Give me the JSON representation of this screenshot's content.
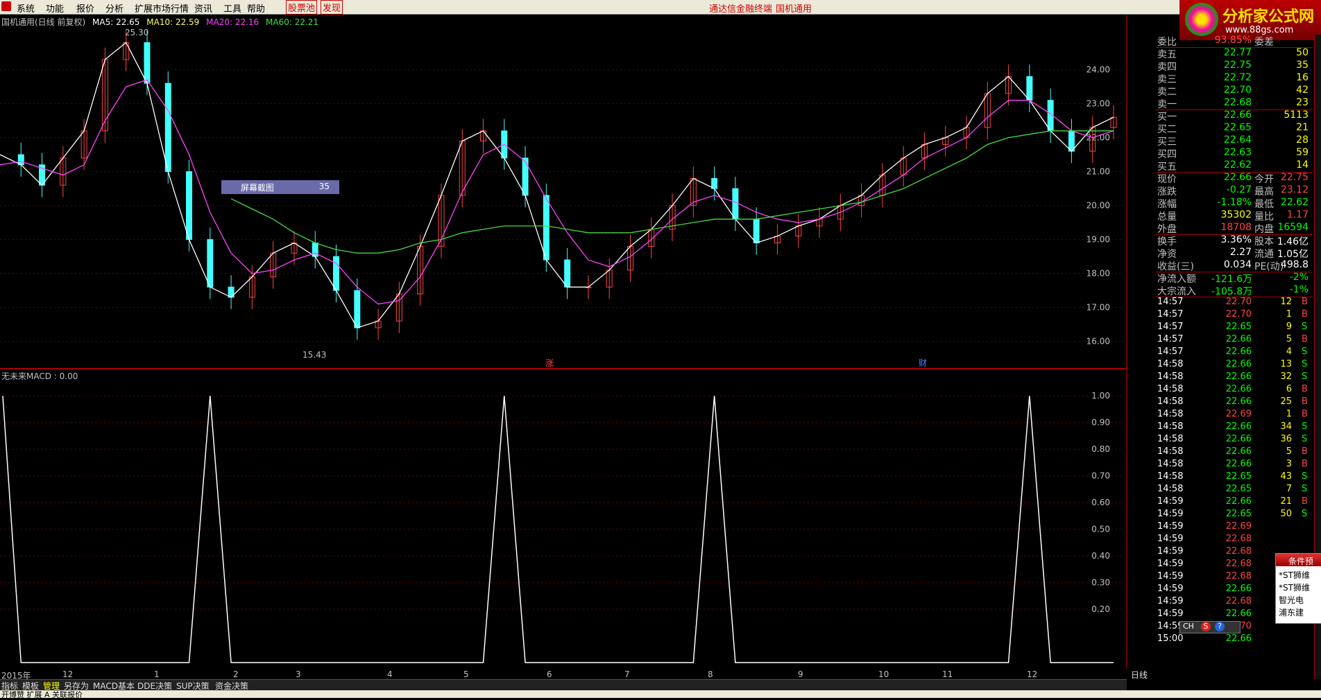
{
  "menu": {
    "items": [
      "系统",
      "功能",
      "报价",
      "分析",
      "扩展市场行情",
      "资讯",
      "工具",
      "帮助"
    ],
    "highlight_items": [
      "股票池",
      "发现"
    ],
    "center_links": [
      "通达信金融终端",
      "国机通用"
    ]
  },
  "brand": {
    "name": "分析家公式网",
    "url": "www.88gs.com"
  },
  "chart": {
    "title": "国机通用(日线 前复权)",
    "ma": [
      {
        "label": "MA5: 22.65",
        "color": "#ffffff"
      },
      {
        "label": "MA10: 22.59",
        "color": "#ffff66"
      },
      {
        "label": "MA20: 22.16",
        "color": "#ff44ff"
      },
      {
        "label": "MA60: 22.21",
        "color": "#44dd44"
      }
    ],
    "high_label": "25.30",
    "low_label": "15.43",
    "markers": [
      "涨",
      "财"
    ],
    "popup": {
      "text": "屏幕截图",
      "value": "35"
    }
  },
  "chart_data": [
    {
      "type": "candlestick",
      "title": "国机通用(日线 前复权)",
      "ylim": [
        15.4,
        25.4
      ],
      "y_ticks": [
        "24.00",
        "23.00",
        "22.00",
        "21.00",
        "20.00",
        "19.00",
        "18.00",
        "17.00",
        "16.00"
      ],
      "x_ticks": [
        "2015年",
        "12",
        "1",
        "2",
        "3",
        "4",
        "5",
        "6",
        "7",
        "8",
        "9",
        "10",
        "11",
        "12"
      ],
      "period_label": "日线",
      "series": [
        {
          "name": "MA5",
          "values": [
            21.5,
            21.2,
            20.6,
            21.4,
            22.2,
            24.3,
            24.8,
            23.6,
            21.0,
            19.0,
            17.6,
            17.3,
            17.9,
            18.6,
            18.9,
            18.5,
            17.5,
            16.4,
            16.6,
            17.4,
            18.8,
            20.3,
            21.9,
            22.2,
            21.4,
            20.3,
            18.4,
            17.6,
            17.6,
            18.1,
            18.8,
            19.3,
            20.0,
            20.8,
            20.5,
            19.6,
            18.9,
            19.1,
            19.4,
            19.6,
            20.0,
            20.3,
            20.9,
            21.4,
            21.8,
            22.0,
            22.3,
            23.3,
            23.8,
            23.1,
            22.2,
            21.6,
            22.3,
            22.6
          ]
        },
        {
          "name": "MA20",
          "values": [
            21.2,
            21.3,
            21.1,
            20.9,
            21.2,
            22.5,
            23.5,
            23.7,
            22.8,
            21.5,
            19.8,
            18.6,
            18.0,
            18.1,
            18.4,
            18.6,
            18.3,
            17.6,
            17.1,
            17.2,
            17.9,
            19.0,
            20.4,
            21.5,
            21.8,
            21.3,
            20.2,
            19.2,
            18.4,
            18.2,
            18.5,
            19.0,
            19.6,
            20.1,
            20.3,
            20.1,
            19.8,
            19.6,
            19.5,
            19.6,
            19.8,
            20.1,
            20.5,
            20.9,
            21.4,
            21.7,
            22.0,
            22.6,
            23.1,
            23.1,
            22.7,
            22.2,
            22.0,
            22.2
          ]
        },
        {
          "name": "MA60",
          "values": [
            null,
            null,
            null,
            null,
            null,
            null,
            null,
            null,
            null,
            null,
            null,
            20.2,
            19.9,
            19.6,
            19.2,
            18.9,
            18.7,
            18.6,
            18.6,
            18.7,
            18.9,
            19.0,
            19.2,
            19.3,
            19.4,
            19.4,
            19.4,
            19.3,
            19.2,
            19.2,
            19.2,
            19.3,
            19.4,
            19.5,
            19.6,
            19.6,
            19.6,
            19.7,
            19.8,
            19.9,
            20.0,
            20.1,
            20.3,
            20.5,
            20.8,
            21.1,
            21.4,
            21.8,
            22.0,
            22.1,
            22.2,
            22.2,
            22.2,
            22.2
          ]
        }
      ]
    },
    {
      "type": "line",
      "title": "无未来MACD : 0.00",
      "ylim": [
        0,
        1.05
      ],
      "y_ticks": [
        "1.00",
        "0.90",
        "0.80",
        "0.70",
        "0.60",
        "0.50",
        "0.40",
        "0.30",
        "0.20"
      ],
      "series": [
        {
          "name": "无未来MACD",
          "values": [
            1,
            0,
            0,
            0,
            0,
            0,
            0,
            0,
            0,
            0,
            1,
            0,
            0,
            0,
            0,
            0,
            0,
            0,
            0,
            0,
            0,
            0,
            0,
            0,
            1,
            0,
            0,
            0,
            0,
            0,
            0,
            0,
            0,
            0,
            1,
            0,
            0,
            0,
            0,
            0,
            0,
            0,
            0,
            0,
            0,
            0,
            0,
            0,
            0,
            1,
            0,
            0,
            0,
            0
          ]
        }
      ]
    }
  ],
  "quote": {
    "header": {
      "label": "委比",
      "value": "93.85%",
      "extra": "委差"
    },
    "asks": [
      {
        "label": "卖五",
        "price": "22.77",
        "qty": "50"
      },
      {
        "label": "卖四",
        "price": "22.75",
        "qty": "35"
      },
      {
        "label": "卖三",
        "price": "22.72",
        "qty": "16"
      },
      {
        "label": "卖二",
        "price": "22.70",
        "qty": "42"
      },
      {
        "label": "卖一",
        "price": "22.68",
        "qty": "23"
      }
    ],
    "bids": [
      {
        "label": "买一",
        "price": "22.66",
        "qty": "5113"
      },
      {
        "label": "买二",
        "price": "22.65",
        "qty": "21"
      },
      {
        "label": "买三",
        "price": "22.64",
        "qty": "28"
      },
      {
        "label": "买四",
        "price": "22.63",
        "qty": "59"
      },
      {
        "label": "买五",
        "price": "22.62",
        "qty": "14"
      }
    ],
    "stats": [
      {
        "l": "现价",
        "v": "22.66",
        "vc": "#00ff00",
        "l2": "今开",
        "q": "22.75",
        "qc": "#ff4444"
      },
      {
        "l": "涨跌",
        "v": "-0.27",
        "vc": "#00ff00",
        "l2": "最高",
        "q": "23.12",
        "qc": "#ff4444"
      },
      {
        "l": "涨幅",
        "v": "-1.18%",
        "vc": "#00ff00",
        "l2": "最低",
        "q": "22.62",
        "qc": "#00ff00"
      },
      {
        "l": "总量",
        "v": "35302",
        "vc": "#ffff00",
        "l2": "量比",
        "q": "1.17",
        "qc": "#ff4444"
      },
      {
        "l": "外盘",
        "v": "18708",
        "vc": "#ff4444",
        "l2": "内盘",
        "q": "16594",
        "qc": "#00ff00"
      }
    ],
    "stats2": [
      {
        "l": "换手",
        "v": "3.36%",
        "vc": "#ffffff",
        "l2": "股本",
        "q": "1.46亿",
        "qc": "#ffffff"
      },
      {
        "l": "净资",
        "v": "2.27",
        "vc": "#ffffff",
        "l2": "流通",
        "q": "1.05亿",
        "qc": "#ffffff"
      },
      {
        "l": "收益(三)",
        "v": "0.034",
        "vc": "#ffffff",
        "l2": "PE(动)",
        "q": "498.8",
        "qc": "#ffffff"
      }
    ],
    "flows": [
      {
        "l": "净流入额",
        "v": "-121.6万",
        "p": "-2%"
      },
      {
        "l": "大宗流入",
        "v": "-105.8万",
        "p": "-1%"
      }
    ]
  },
  "ticks": [
    {
      "t": "14:57",
      "p": "22.70",
      "pc": "#ff4444",
      "n": "12",
      "s": "B"
    },
    {
      "t": "14:57",
      "p": "22.70",
      "pc": "#ff4444",
      "n": "1",
      "s": "B"
    },
    {
      "t": "14:57",
      "p": "22.65",
      "pc": "#00ff00",
      "n": "9",
      "s": "S"
    },
    {
      "t": "14:57",
      "p": "22.66",
      "pc": "#00ff00",
      "n": "5",
      "s": "B"
    },
    {
      "t": "14:57",
      "p": "22.66",
      "pc": "#00ff00",
      "n": "4",
      "s": "S"
    },
    {
      "t": "14:58",
      "p": "22.66",
      "pc": "#00ff00",
      "n": "13",
      "s": "S"
    },
    {
      "t": "14:58",
      "p": "22.66",
      "pc": "#00ff00",
      "n": "32",
      "s": "S"
    },
    {
      "t": "14:58",
      "p": "22.66",
      "pc": "#00ff00",
      "n": "6",
      "s": "B"
    },
    {
      "t": "14:58",
      "p": "22.66",
      "pc": "#00ff00",
      "n": "25",
      "s": "B"
    },
    {
      "t": "14:58",
      "p": "22.69",
      "pc": "#ff4444",
      "n": "1",
      "s": "B"
    },
    {
      "t": "14:58",
      "p": "22.66",
      "pc": "#00ff00",
      "n": "34",
      "s": "S"
    },
    {
      "t": "14:58",
      "p": "22.66",
      "pc": "#00ff00",
      "n": "36",
      "s": "S"
    },
    {
      "t": "14:58",
      "p": "22.66",
      "pc": "#00ff00",
      "n": "5",
      "s": "B"
    },
    {
      "t": "14:58",
      "p": "22.66",
      "pc": "#00ff00",
      "n": "3",
      "s": "B"
    },
    {
      "t": "14:58",
      "p": "22.65",
      "pc": "#00ff00",
      "n": "43",
      "s": "S"
    },
    {
      "t": "14:58",
      "p": "22.65",
      "pc": "#00ff00",
      "n": "7",
      "s": "S"
    },
    {
      "t": "14:59",
      "p": "22.66",
      "pc": "#00ff00",
      "n": "21",
      "s": "B"
    },
    {
      "t": "14:59",
      "p": "22.65",
      "pc": "#00ff00",
      "n": "50",
      "s": "S"
    },
    {
      "t": "14:59",
      "p": "22.69",
      "pc": "#ff4444",
      "n": "",
      "s": ""
    },
    {
      "t": "14:59",
      "p": "22.68",
      "pc": "#ff4444",
      "n": "",
      "s": ""
    },
    {
      "t": "14:59",
      "p": "22.68",
      "pc": "#ff4444",
      "n": "",
      "s": ""
    },
    {
      "t": "14:59",
      "p": "22.68",
      "pc": "#ff4444",
      "n": "",
      "s": ""
    },
    {
      "t": "14:59",
      "p": "22.68",
      "pc": "#ff4444",
      "n": "",
      "s": ""
    },
    {
      "t": "14:59",
      "p": "22.66",
      "pc": "#00ff00",
      "n": "",
      "s": ""
    },
    {
      "t": "14:59",
      "p": "22.68",
      "pc": "#ff4444",
      "n": "",
      "s": ""
    },
    {
      "t": "14:59",
      "p": "22.66",
      "pc": "#00ff00",
      "n": "",
      "s": ""
    },
    {
      "t": "14:59",
      "p": "22.70",
      "pc": "#ff4444",
      "n": "",
      "s": ""
    },
    {
      "t": "15:00",
      "p": "22.66",
      "pc": "#00ff00",
      "n": "",
      "s": ""
    }
  ],
  "tabs": {
    "items": [
      "指标",
      "模板",
      "管理",
      "另存为",
      "MACD基本",
      "DDE决策",
      "SUP决策",
      "资金决策"
    ],
    "active": "管理"
  },
  "float_window": {
    "title": "条件预",
    "items": [
      "*ST狮维",
      "*ST狮维",
      "智光电",
      "浦东建"
    ]
  },
  "floatbar": {
    "label": "CH"
  },
  "status": {
    "text": "开博赞 扩展 A 关联报价"
  }
}
